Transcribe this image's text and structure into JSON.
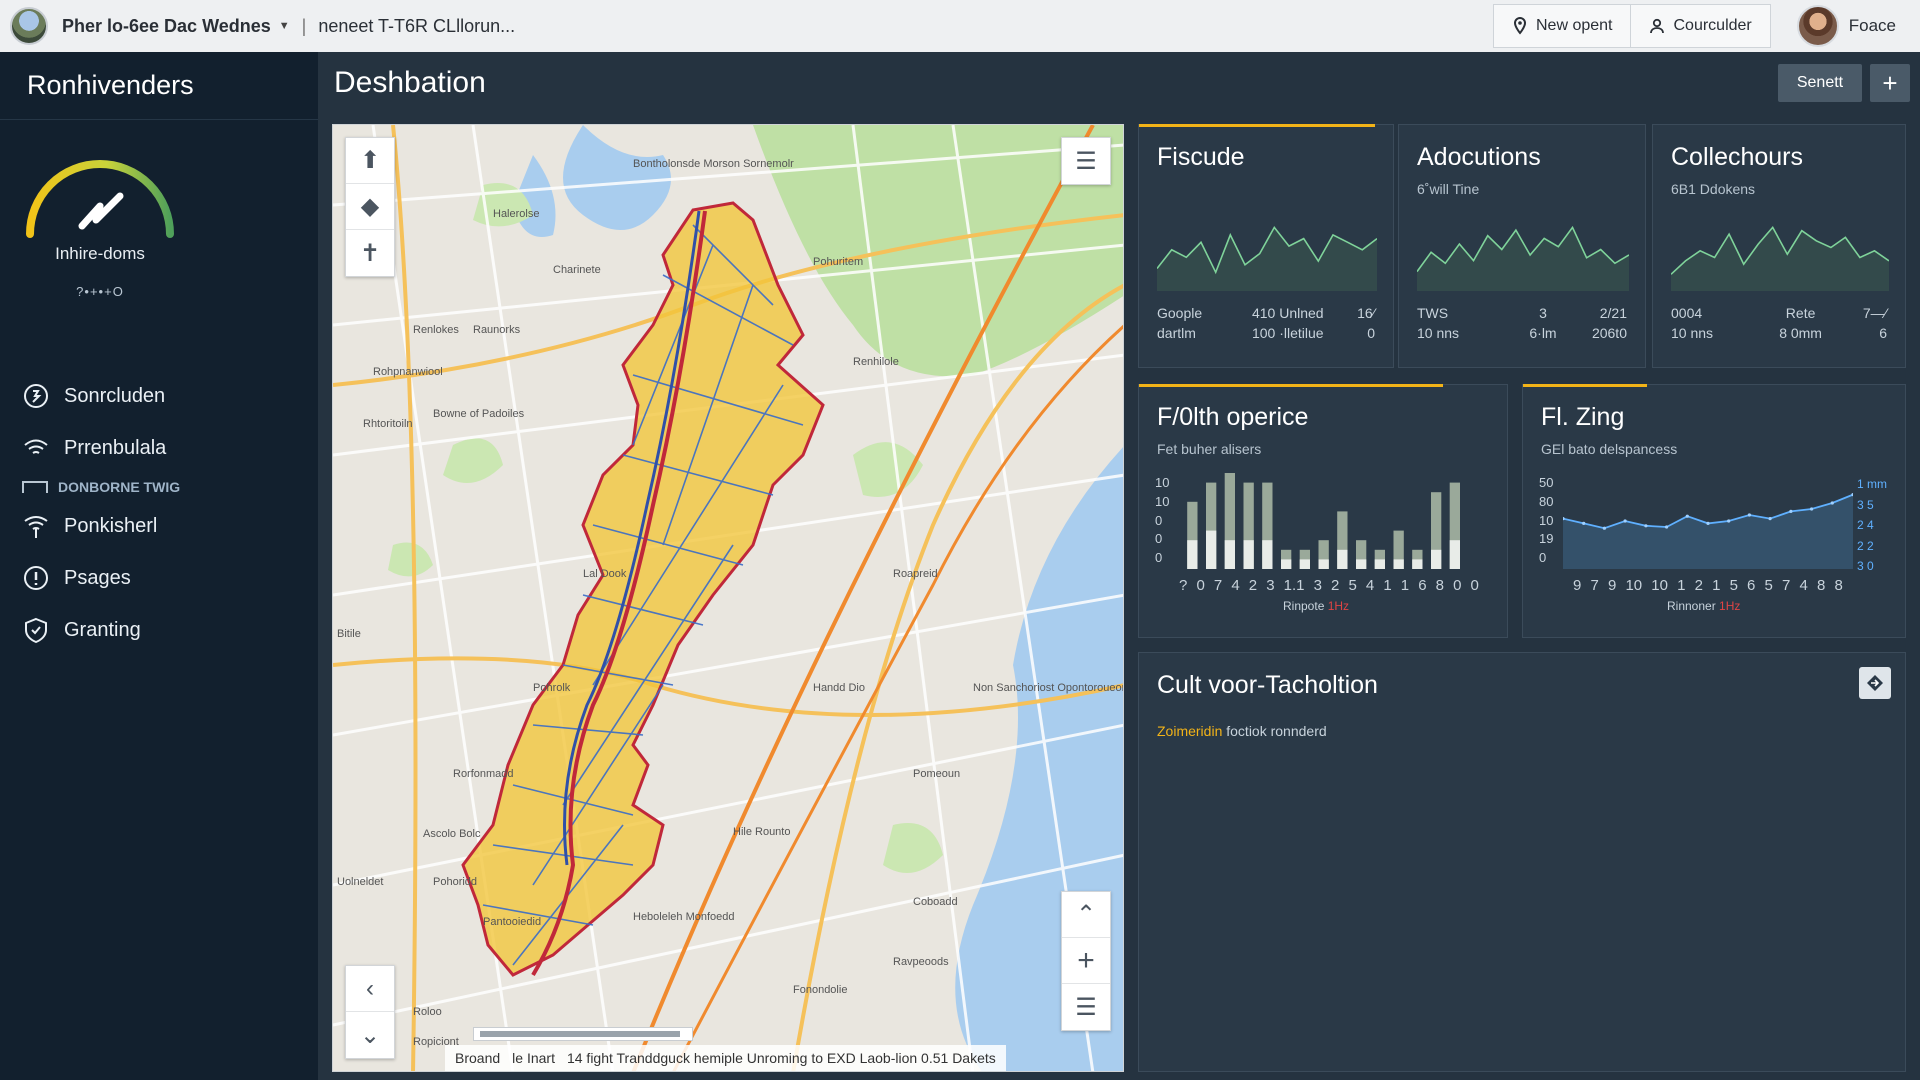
{
  "topbar": {
    "doc_title": "Pher lo-6ee Dac Wednes",
    "crumb": "neneet T-T6R CLllorun...",
    "new_button": "New opent",
    "counter_button": "Courculder",
    "user_name": "Foace"
  },
  "sidebar": {
    "brand": "Ronhivenders",
    "gauge_label": "Inhire-doms",
    "gauge_sub": "?•+•+O",
    "items": [
      {
        "label": "Sonrcluden",
        "icon": "badge-icon"
      },
      {
        "label": "Prrenbulala",
        "icon": "wifi-icon"
      }
    ],
    "group_label": "DONBORNE TWIG",
    "items2": [
      {
        "label": "Ponkisherl",
        "icon": "signal-icon"
      },
      {
        "label": "Psages",
        "icon": "info-icon"
      },
      {
        "label": "Granting",
        "icon": "shield-icon"
      }
    ]
  },
  "header": {
    "title": "Deshbation",
    "senett_button": "Senett",
    "plus_button": "+"
  },
  "map": {
    "footer_a": "Broand",
    "footer_b": "le Inart",
    "footer_c": "14 fight Tranddguck hemiple Unroming to EXD Laob-lion 0.51 Dakets",
    "labels": [
      "Bontholonsde Morson Sornemolr",
      "Halerolse",
      "Charinete",
      "Raunorks",
      "Renlokes",
      "Bowne of Padoiles",
      "Pohuritem",
      "Renhilole",
      "Lal Dook",
      "Roapreid",
      "Pohrolk",
      "Handd Dio",
      "Non Sanchoriost Opontoroueonol",
      "Pomeoun",
      "Rorfonmadd",
      "Ascolo Bolc",
      "Hile Rounto",
      "Uolneldet",
      "Pohoridd",
      "Ropiciont",
      "Ravpeoods",
      "Fonondolie",
      "Roloo",
      "Rohpnanwiool",
      "Rhtoritoiln",
      "Bitile",
      "Heboleleh Monfoedd",
      "Pantooiedid",
      "Coboadd"
    ]
  },
  "cards": {
    "fiscude": {
      "title": "Fiscude",
      "sub": "",
      "stats": [
        "Goople",
        "410 Unlned",
        "16⁄",
        "dartlm",
        "100 ·lletilue",
        "0"
      ]
    },
    "adocutions": {
      "title": "Adocutions",
      "sub": "6˚will Tine",
      "stats": [
        "TWS",
        "3",
        "2/21",
        "10 nns",
        "6·lm",
        "206t0"
      ]
    },
    "collechours": {
      "title": "Collechours",
      "sub": "6B1 Ddokens",
      "stats": [
        "0004",
        "Rete",
        "7—⁄",
        "10 nns",
        "8 0mm",
        "6"
      ]
    },
    "folth": {
      "title": "F/0lth operice",
      "sub": "Fet buher alisers",
      "y_ticks": [
        "10",
        "10",
        "0",
        "0",
        "0"
      ],
      "x_ticks": [
        "?",
        "0",
        "7",
        "4",
        "2",
        "3",
        "1.1",
        "3",
        "2",
        "5",
        "4",
        "1",
        "1",
        "6",
        "8",
        "0",
        "0"
      ],
      "x_caption": "Rinpote",
      "x_caption_red": "1Hz"
    },
    "flzing": {
      "title": "Fl. Zing",
      "sub": "GEl bato delspancess",
      "y_ticks": [
        "50",
        "80",
        "10",
        "19",
        "0"
      ],
      "x_ticks": [
        "9",
        "7",
        "9",
        "10",
        "10",
        "1",
        "2",
        "1",
        "5",
        "6",
        "5",
        "7",
        "4",
        "8",
        "8"
      ],
      "right_ticks": [
        "1 mm",
        "3 5",
        "2 4",
        "2 2",
        "3 0"
      ],
      "x_caption": "Rinnoner",
      "x_caption_red": "1Hz"
    },
    "cult": {
      "title": "Cult voor-Tacholtion",
      "sub_highlight": "Zoimeridin",
      "sub_rest": "foctiok ronnderd"
    }
  },
  "chart_data": [
    {
      "type": "bar",
      "title": "F/0lth operice",
      "categories": [
        "0",
        "7",
        "4",
        "2",
        "3",
        "1.1",
        "3",
        "2",
        "5",
        "4",
        "1",
        "1",
        "6",
        "8",
        "0",
        "0"
      ],
      "series": [
        {
          "values": [
            7,
            9,
            10,
            9,
            9,
            2,
            2,
            3,
            6,
            3,
            2,
            4,
            2,
            8,
            9,
            0
          ]
        },
        {
          "values": [
            3,
            4,
            3,
            3,
            3,
            1,
            1,
            1,
            2,
            1,
            1,
            1,
            1,
            2,
            3,
            0
          ]
        }
      ],
      "ylim": [
        0,
        10
      ]
    },
    {
      "type": "line",
      "title": "Fl. Zing",
      "x": [
        "9",
        "7",
        "9",
        "10",
        "10",
        "1",
        "2",
        "1",
        "5",
        "6",
        "5",
        "7",
        "4",
        "8",
        "8"
      ],
      "series": [
        {
          "values": [
            42,
            38,
            34,
            40,
            36,
            35,
            44,
            38,
            40,
            45,
            42,
            48,
            50,
            55,
            62
          ]
        }
      ],
      "ylim": [
        0,
        80
      ]
    },
    {
      "type": "line",
      "title": "Fiscude",
      "series": [
        {
          "values": [
            12,
            22,
            18,
            26,
            10,
            30,
            14,
            20,
            34,
            24,
            28,
            16,
            30,
            26,
            22,
            28
          ]
        }
      ]
    },
    {
      "type": "line",
      "title": "Adocutions",
      "series": [
        {
          "values": [
            14,
            28,
            20,
            34,
            22,
            40,
            30,
            44,
            26,
            38,
            32,
            46,
            24,
            30,
            20,
            26
          ]
        }
      ]
    },
    {
      "type": "line",
      "title": "Collechours",
      "series": [
        {
          "values": [
            10,
            18,
            24,
            20,
            34,
            16,
            28,
            38,
            22,
            36,
            30,
            26,
            32,
            20,
            24,
            18
          ]
        }
      ]
    }
  ]
}
